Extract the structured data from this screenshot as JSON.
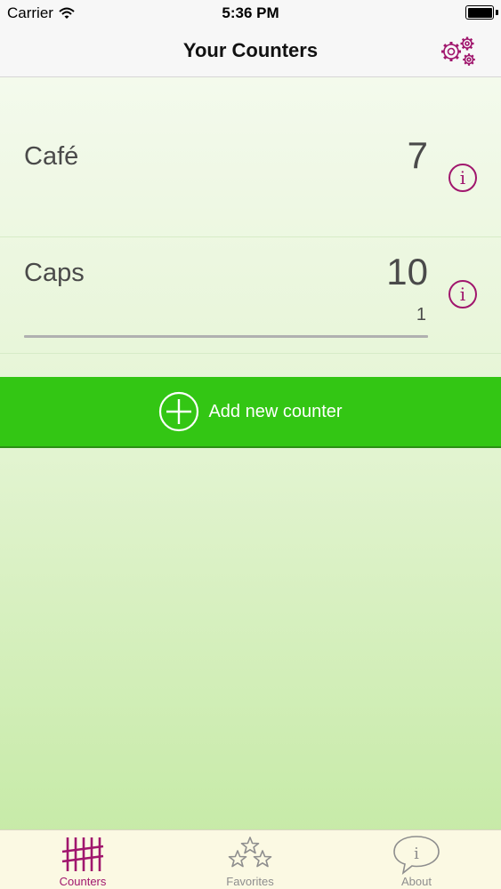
{
  "status_bar": {
    "carrier": "Carrier",
    "time": "5:36 PM"
  },
  "nav": {
    "title": "Your Counters",
    "settings_icon": "gear-icon"
  },
  "counters": [
    {
      "name": "Café",
      "value": "7",
      "step": ""
    },
    {
      "name": "Caps",
      "value": "10",
      "step": "1"
    }
  ],
  "add_button": {
    "label": "Add new counter"
  },
  "tabs": [
    {
      "label": "Counters",
      "icon": "tally-icon",
      "selected": true
    },
    {
      "label": "Favorites",
      "icon": "stars-icon",
      "selected": false
    },
    {
      "label": "About",
      "icon": "info-bubble-icon",
      "selected": false
    }
  ],
  "colors": {
    "accent": "#a0166d",
    "add_button": "#33c614",
    "tab_inactive": "#8e8e8e"
  }
}
